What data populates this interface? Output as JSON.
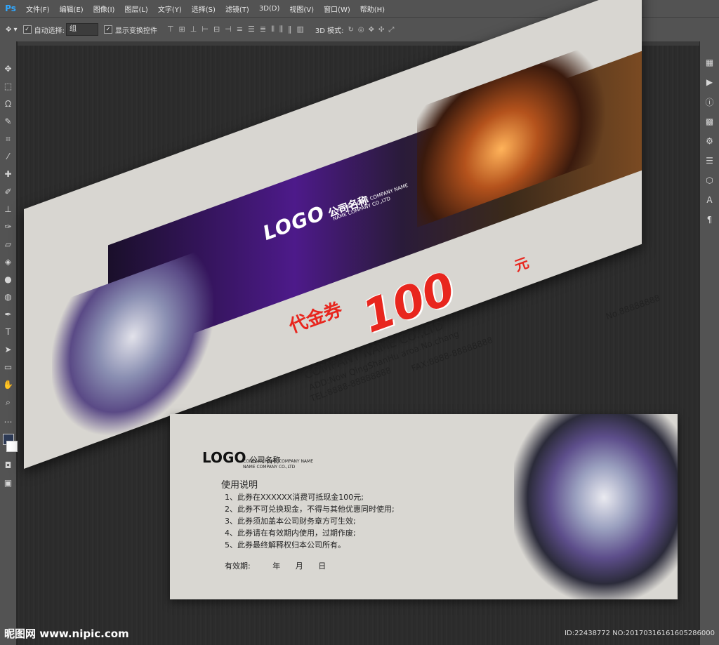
{
  "app": {
    "logo": "Ps"
  },
  "menu": [
    "文件(F)",
    "编辑(E)",
    "图像(I)",
    "图层(L)",
    "文字(Y)",
    "选择(S)",
    "滤镜(T)",
    "3D(D)",
    "视图(V)",
    "窗口(W)",
    "帮助(H)"
  ],
  "options": {
    "auto_select_label": "自动选择:",
    "auto_select_value": "组",
    "show_transform_label": "显示变换控件",
    "mode_3d_label": "3D 模式:"
  },
  "voucher_front": {
    "logo": "LOGO",
    "company_cn": "公司名称",
    "company_en_line1": "COMPANY NAME COMPANY NAME",
    "company_en_line2": "NAME COMPANY CO.,LTD",
    "title": "代金券",
    "amount": "100",
    "unit": "元",
    "serial": "No.88888888",
    "company_name": "COMPANY NAME CO.,LTD",
    "address": "ADD:Now QingShanHu aroa.No.chang",
    "tel": "TEL:8888-88888888",
    "fax": "FAX:8888-88888888"
  },
  "voucher_back": {
    "logo": "LOGO",
    "company_cn": "公司名称",
    "company_en_line1": "COMPANY NAME COMPANY NAME",
    "company_en_line2": "NAME COMPANY CO.,LTD",
    "heading": "使用说明",
    "rules": [
      "1、此券在XXXXXX消费可抵现金100元;",
      "2、此券不可兑换现金，不得与其他优惠同时使用;",
      "3、此券须加盖本公司财务章方可生效;",
      "4、此券请在有效期内使用，过期作废;",
      "5、此券最终解释权归本公司所有。"
    ],
    "validity_label": "有效期:",
    "year": "年",
    "month": "月",
    "day": "日"
  },
  "watermark": {
    "left": "昵图网 www.nipic.com",
    "right": "ID:22438772 NO:20170316161605286000"
  }
}
